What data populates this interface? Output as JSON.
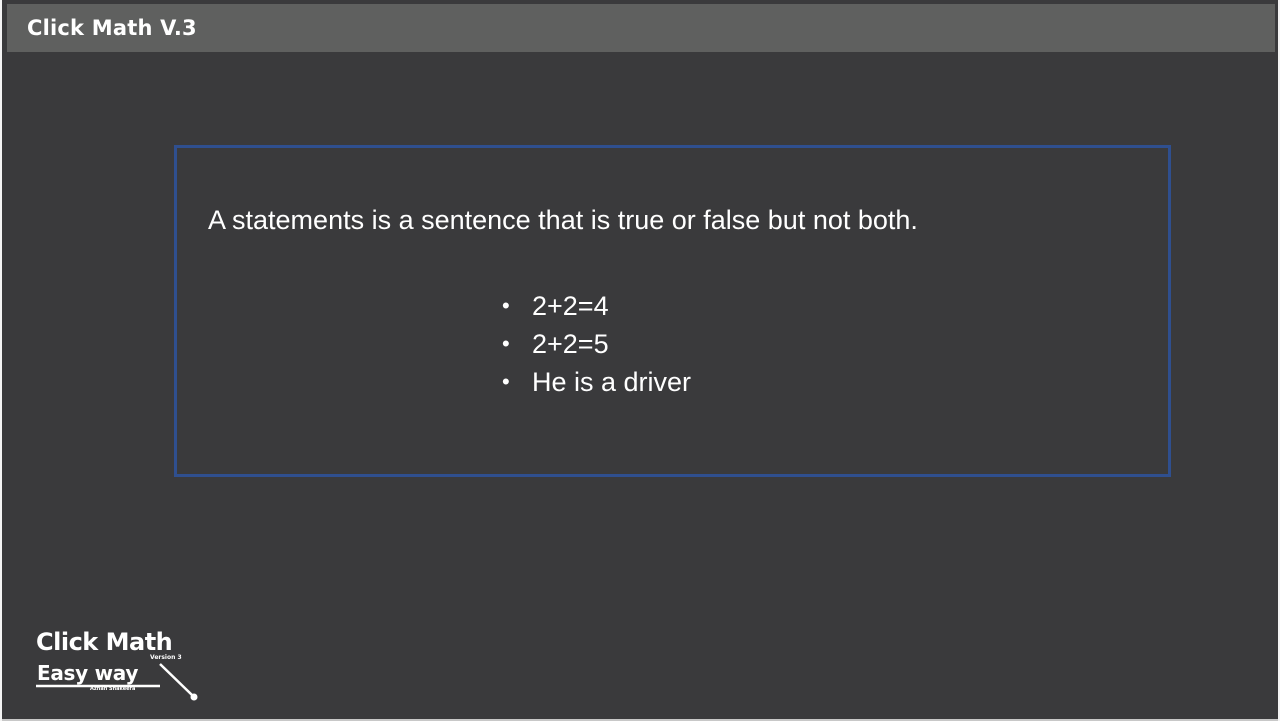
{
  "header": {
    "title": "Click Math V.3"
  },
  "content": {
    "statement": "A statements is a sentence that is true or false but not both.",
    "examples": [
      "2+2=4",
      "2+2=5",
      "He is a driver"
    ],
    "bullet_char": "•"
  },
  "logo": {
    "main": "Click Math",
    "version": "Version 3",
    "sub": "Easy way",
    "author": "Azhan Shakeera"
  },
  "colors": {
    "background": "#3a3a3c",
    "titlebar": "#5f605f",
    "box_border": "#2f4f8f",
    "text": "#ffffff"
  }
}
